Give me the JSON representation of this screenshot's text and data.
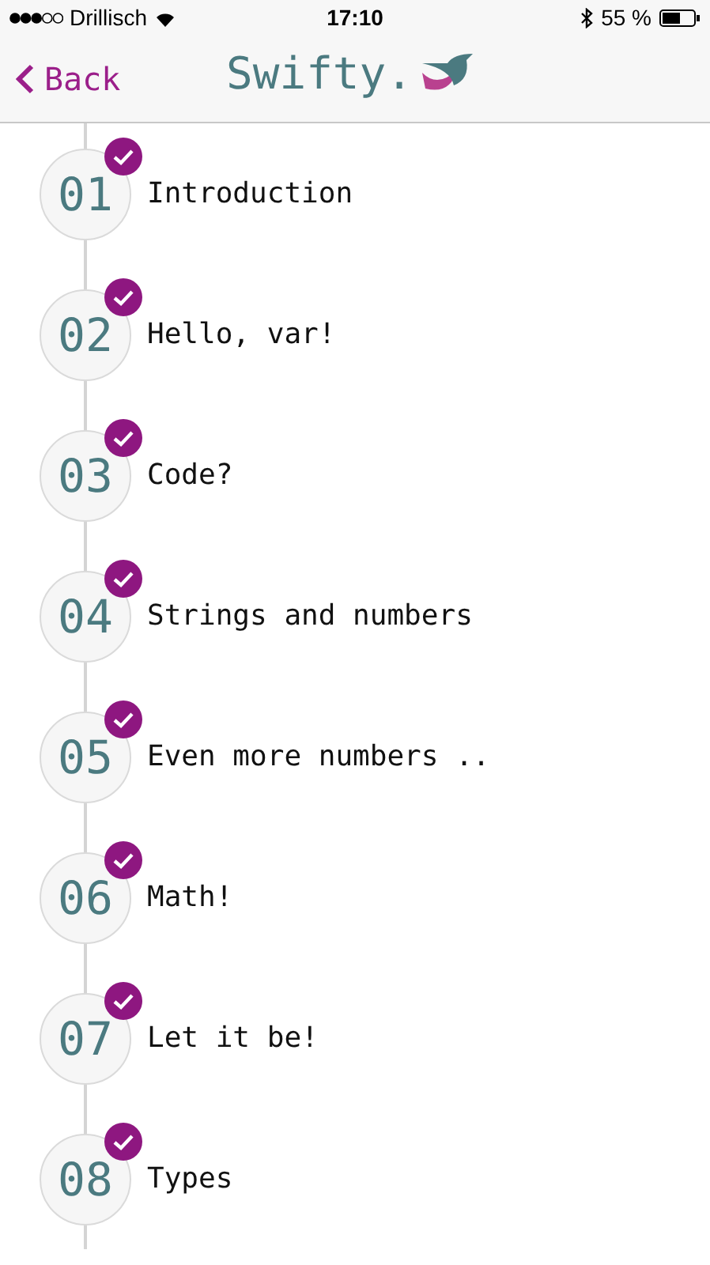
{
  "status_bar": {
    "carrier": "Drillisch",
    "time": "17:10",
    "battery": "55 %"
  },
  "nav_bar": {
    "back": "Back",
    "title": "Swifty."
  },
  "lessons": [
    {
      "number": "01",
      "title": "Introduction",
      "completed": true
    },
    {
      "number": "02",
      "title": "Hello, var!",
      "completed": true
    },
    {
      "number": "03",
      "title": "Code?",
      "completed": true
    },
    {
      "number": "04",
      "title": "Strings and numbers",
      "completed": true
    },
    {
      "number": "05",
      "title": "Even more numbers ..",
      "completed": true
    },
    {
      "number": "06",
      "title": "Math!",
      "completed": true
    },
    {
      "number": "07",
      "title": "Let it be!",
      "completed": true
    },
    {
      "number": "08",
      "title": "Types",
      "completed": true
    }
  ]
}
